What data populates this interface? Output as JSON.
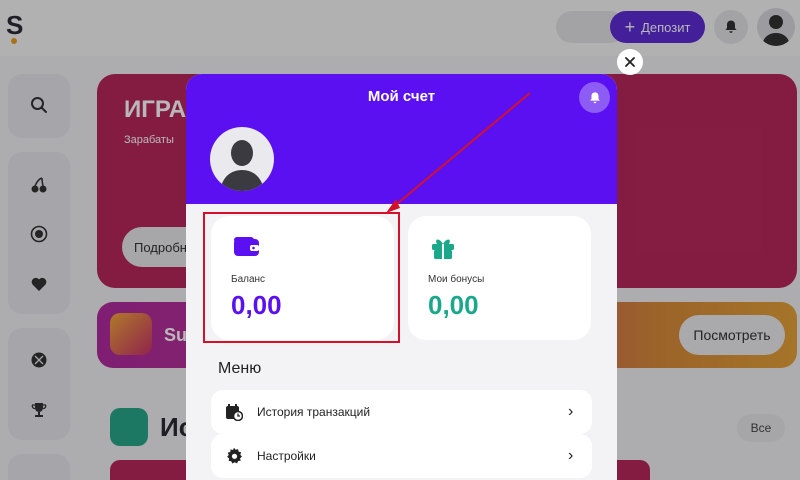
{
  "header": {
    "logo": "S",
    "deposit_label": "Депозит"
  },
  "background": {
    "hero_title": "ИГРА",
    "hero_subtitle": "Зарабаты",
    "hero_button": "Подробн",
    "promo_text": "Su",
    "promo_button": "Посмотреть",
    "section_title": "Ис",
    "all_button": "Все"
  },
  "modal": {
    "title": "Мой счет",
    "balance": {
      "label": "Баланс",
      "value": "0,00"
    },
    "bonus": {
      "label": "Мои бонусы",
      "value": "0,00"
    },
    "menu_title": "Меню",
    "menu_items": [
      {
        "label": "История транзакций",
        "icon": "calendar-clock-icon"
      },
      {
        "label": "Настройки",
        "icon": "gear-icon"
      }
    ]
  },
  "colors": {
    "brand": "#5a10f0",
    "bonus": "#1aa88a",
    "annotation": "#d4102a"
  }
}
